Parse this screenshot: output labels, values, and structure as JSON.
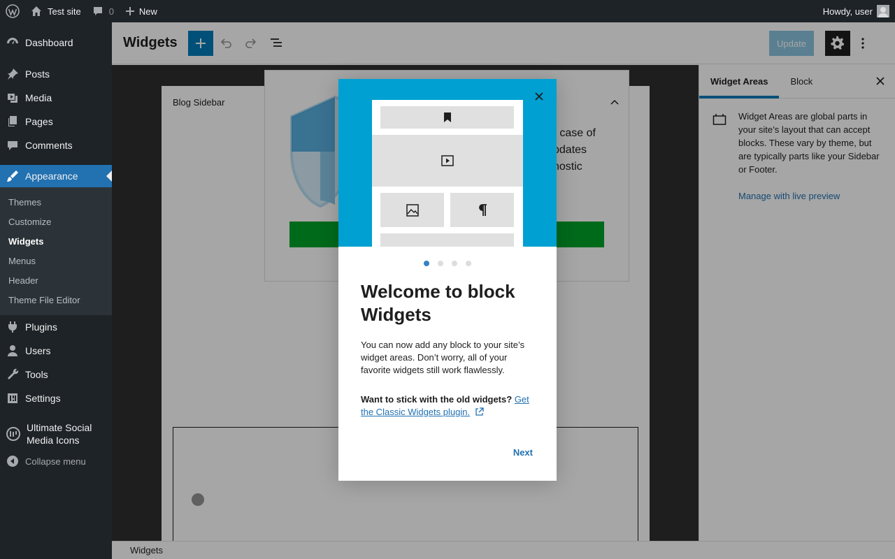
{
  "admin_bar": {
    "site_name": "Test site",
    "comments_count": "0",
    "new_label": "New",
    "greeting": "Howdy, user"
  },
  "sidebar": {
    "items_top": [
      {
        "label": "Dashboard",
        "icon": "dashboard-icon"
      },
      {
        "label": "Posts",
        "icon": "pin-icon"
      },
      {
        "label": "Media",
        "icon": "media-icon"
      },
      {
        "label": "Pages",
        "icon": "pages-icon"
      },
      {
        "label": "Comments",
        "icon": "comment-icon"
      }
    ],
    "appearance": "Appearance",
    "submenu": [
      "Themes",
      "Customize",
      "Widgets",
      "Menus",
      "Header",
      "Theme File Editor"
    ],
    "items_bottom": [
      {
        "label": "Plugins",
        "icon": "plugin-icon"
      },
      {
        "label": "Users",
        "icon": "users-icon"
      },
      {
        "label": "Tools",
        "icon": "tools-icon"
      },
      {
        "label": "Settings",
        "icon": "settings-icon"
      }
    ],
    "social_line1": "Ultimate Social",
    "social_line2": "Media Icons",
    "collapse": "Collapse menu"
  },
  "editor": {
    "title": "Widgets",
    "update_label": "Update",
    "widget_area_title": "Blog Sidebar",
    "plugin_text_1": "n case of",
    "plugin_text_2": "pdates",
    "plugin_text_3": "nostic",
    "footer_crumb": "Widgets"
  },
  "settings_panel": {
    "tab_widget_areas": "Widget Areas",
    "tab_block": "Block",
    "description": "Widget Areas are global parts in your site’s layout that can accept blocks. These vary by theme, but are typically parts like your Sidebar or Footer.",
    "manage_link": "Manage with live preview"
  },
  "modal": {
    "heading": "Welcome to block Widgets",
    "body": "You can now add any block to your site’s widget areas. Don’t worry, all of your favorite widgets still work flawlessly.",
    "old_widgets_q": "Want to stick with the old widgets?",
    "classic_link": "Get the Classic Widgets plugin.",
    "next_label": "Next",
    "page_current": 1,
    "page_total": 4
  },
  "colors": {
    "admin_dark": "#1d2327",
    "accent": "#2271b1",
    "hero": "#00a0d2",
    "plugin_button": "#00a32a"
  }
}
